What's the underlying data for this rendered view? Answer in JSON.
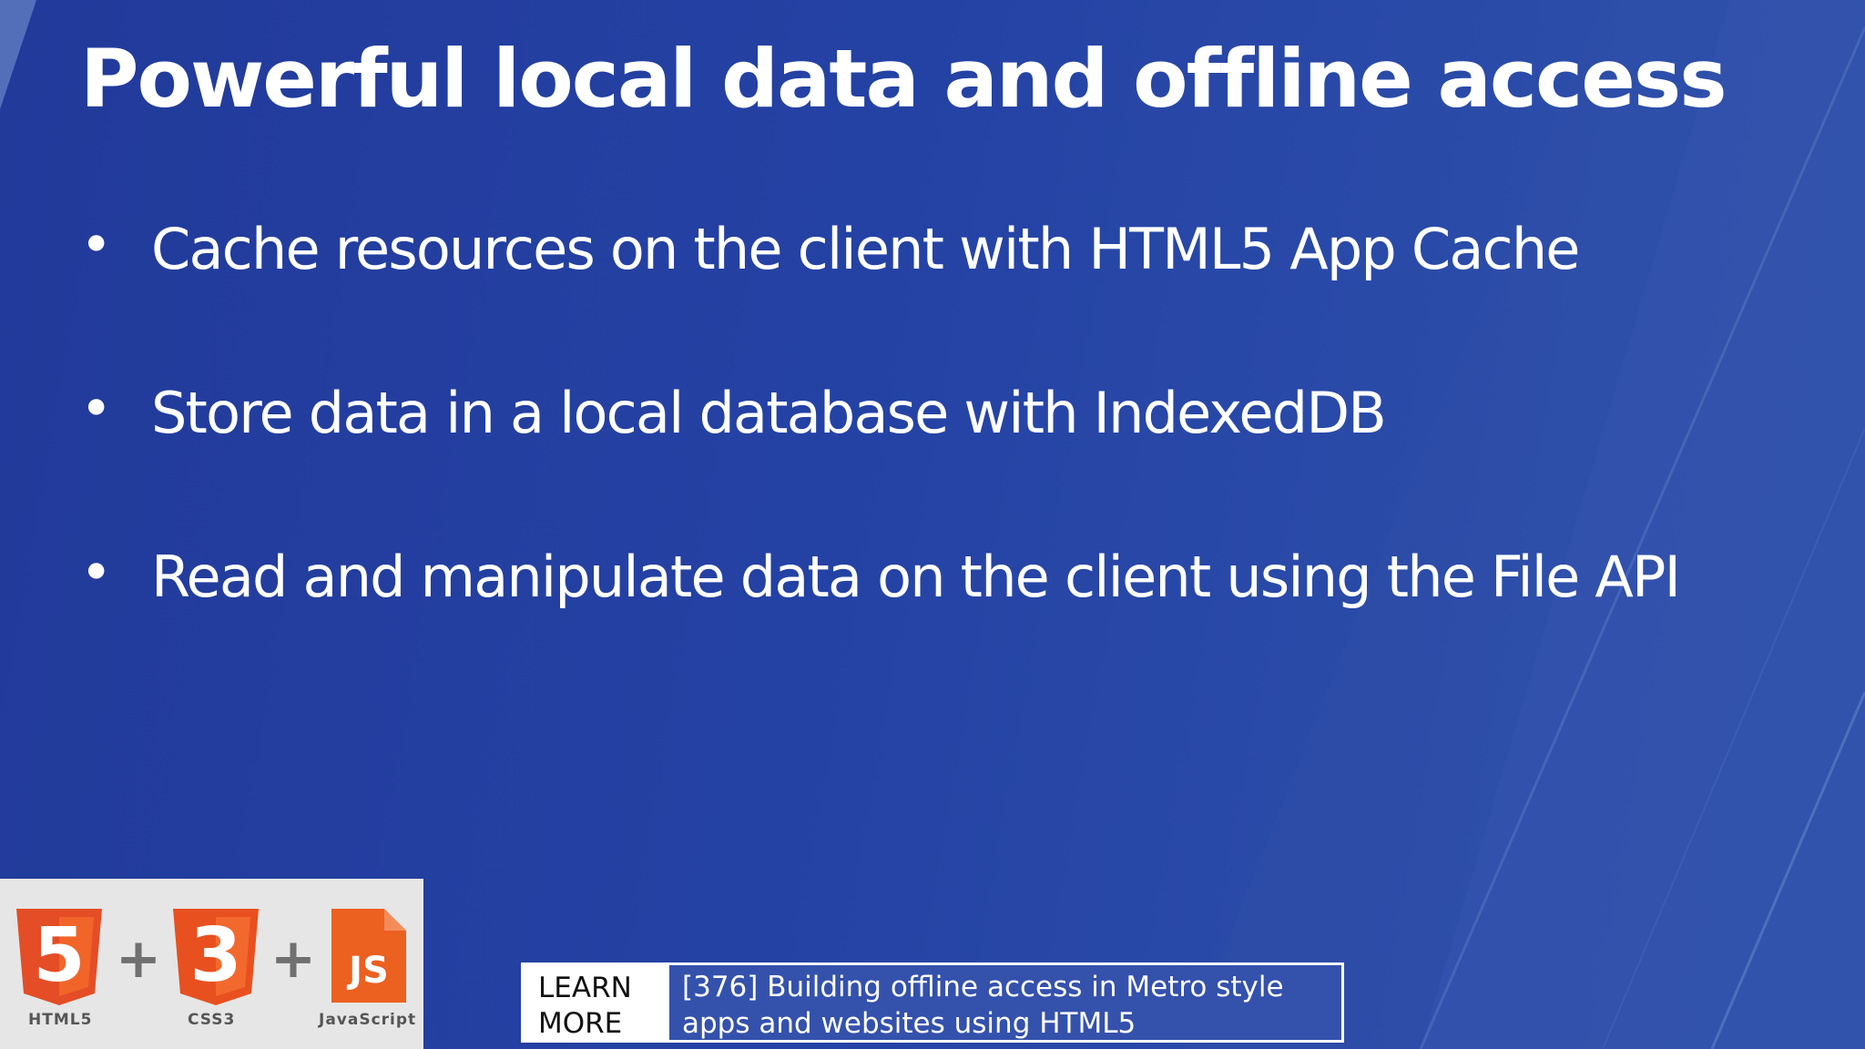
{
  "slide": {
    "title": "Powerful local data and offline access",
    "bullets": [
      {
        "text": "Cache resources on the client with HTML5 App Cache"
      },
      {
        "text": "Store data in a local database with IndexedDB"
      },
      {
        "text": "Read and manipulate data on the client using the File API"
      }
    ],
    "bullet_glyph": "•"
  },
  "logos": {
    "items": [
      {
        "icon": "html5-logo-icon",
        "label": "HTML5",
        "glyph": "5"
      },
      {
        "icon": "css3-logo-icon",
        "label": "CSS3",
        "glyph": "3"
      },
      {
        "icon": "javascript-logo-icon",
        "label": "JavaScript",
        "glyph": "JS"
      }
    ],
    "separator": "+"
  },
  "learn_more": {
    "label_line1": "LEARN",
    "label_line2": "MORE",
    "text_line1": "[376] Building offline access in Metro style",
    "text_line2": "apps and websites using HTML5"
  },
  "colors": {
    "background": "#2340a0",
    "logo_orange": "#e8501f",
    "text": "#ffffff"
  }
}
